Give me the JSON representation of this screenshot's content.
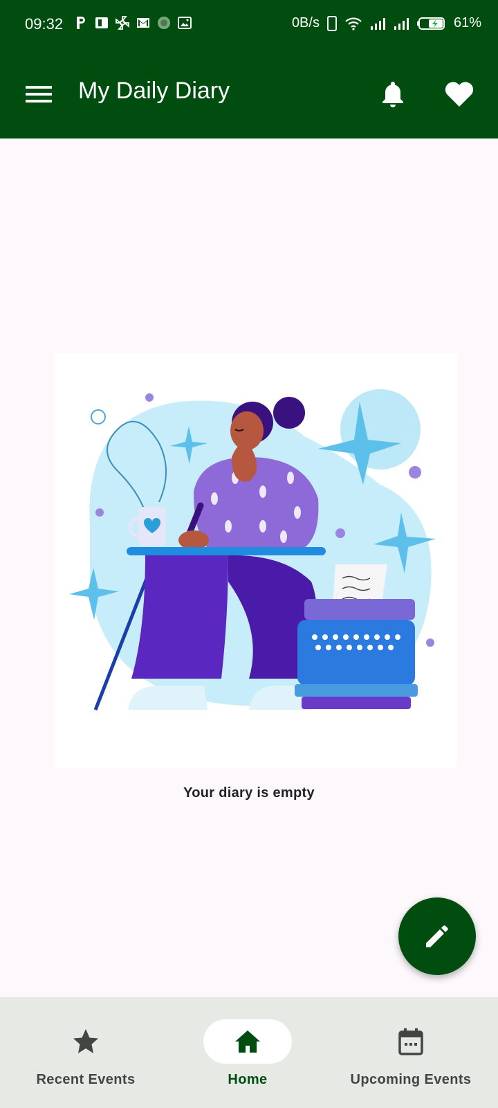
{
  "status_bar": {
    "time": "09:32",
    "net_speed": "0B/s",
    "battery": "61%",
    "icons": [
      "p-icon",
      "office-icon",
      "pinwheel-icon",
      "gmail-icon",
      "app-icon",
      "gallery-icon",
      "phone-icon",
      "wifi-icon",
      "signal-icon",
      "signal-icon",
      "battery-icon"
    ]
  },
  "app_bar": {
    "title": "My Daily Diary",
    "icons": [
      "menu-icon",
      "bell-icon",
      "heart-icon"
    ]
  },
  "main": {
    "empty_message": "Your diary is empty"
  },
  "fab": {
    "icon": "pencil-icon"
  },
  "bottom_nav": {
    "items": [
      {
        "label": "Recent Events",
        "icon": "star-icon",
        "active": false
      },
      {
        "label": "Home",
        "icon": "home-icon",
        "active": true
      },
      {
        "label": "Upcoming Events",
        "icon": "calendar-icon",
        "active": false
      }
    ]
  },
  "colors": {
    "primary": "#004d10",
    "background": "#fdf8fb",
    "nav_background": "#e6e9e4"
  }
}
